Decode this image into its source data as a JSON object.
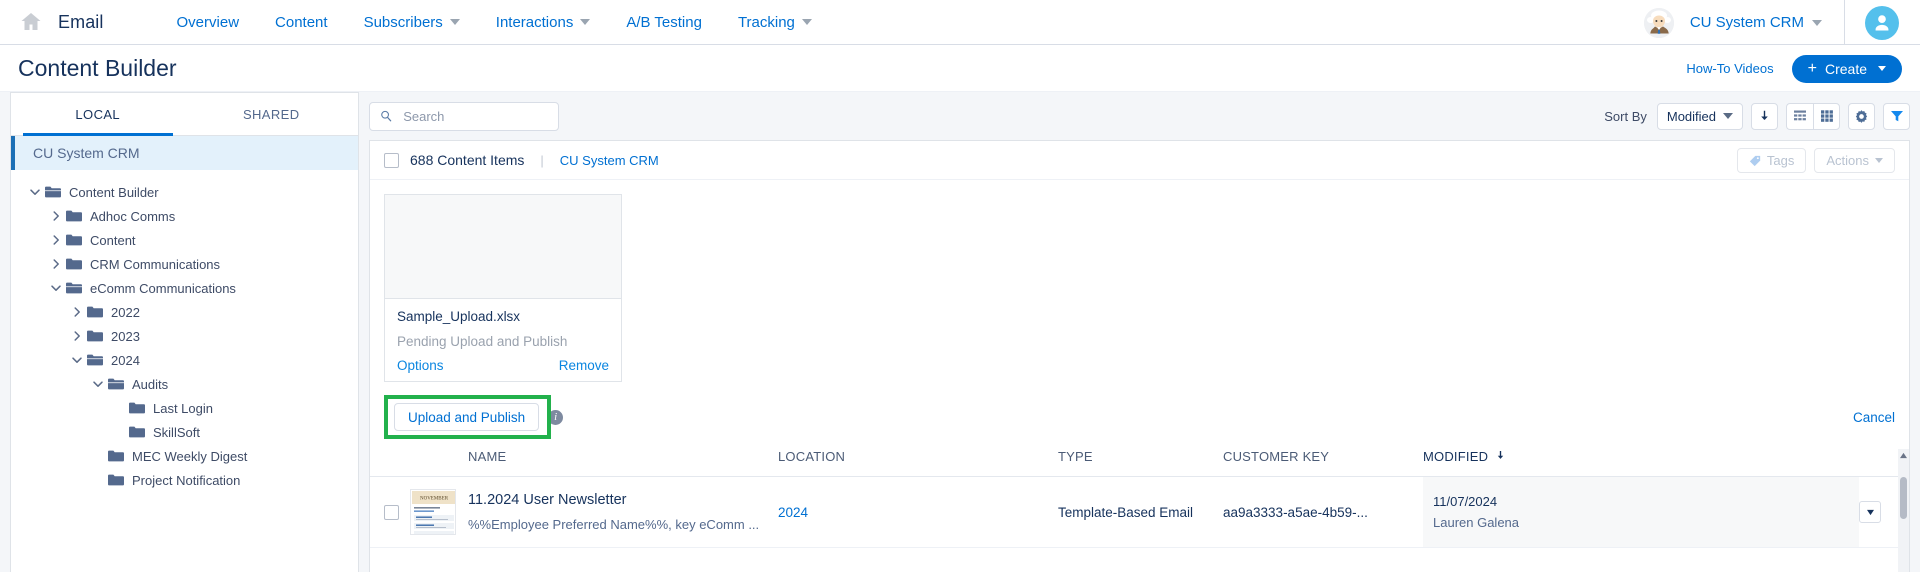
{
  "topnav": {
    "home_icon": "home-icon",
    "app_name": "Email",
    "items": [
      {
        "label": "Overview",
        "caret": false
      },
      {
        "label": "Content",
        "caret": false
      },
      {
        "label": "Subscribers",
        "caret": true
      },
      {
        "label": "Interactions",
        "caret": true
      },
      {
        "label": "A/B Testing",
        "caret": false
      },
      {
        "label": "Tracking",
        "caret": true
      }
    ],
    "assistant_icon": "einstein-assistant-icon",
    "org": "CU System CRM",
    "avatar_icon": "user-avatar-icon"
  },
  "header": {
    "title": "Content Builder",
    "howto": "How-To Videos",
    "create": "Create",
    "create_plus": "+"
  },
  "sidebar": {
    "tabs": [
      {
        "label": "LOCAL",
        "active": true
      },
      {
        "label": "SHARED",
        "active": false
      }
    ],
    "root": "CU System CRM",
    "tree": [
      {
        "label": "Content Builder",
        "indent": 0,
        "twisty": "down",
        "folder": "open"
      },
      {
        "label": "Adhoc Comms",
        "indent": 1,
        "twisty": "right",
        "folder": "closed"
      },
      {
        "label": "Content",
        "indent": 1,
        "twisty": "right",
        "folder": "closed"
      },
      {
        "label": "CRM Communications",
        "indent": 1,
        "twisty": "right",
        "folder": "closed"
      },
      {
        "label": "eComm Communications",
        "indent": 1,
        "twisty": "down",
        "folder": "open"
      },
      {
        "label": "2022",
        "indent": 2,
        "twisty": "right",
        "folder": "closed"
      },
      {
        "label": "2023",
        "indent": 2,
        "twisty": "right",
        "folder": "closed"
      },
      {
        "label": "2024",
        "indent": 2,
        "twisty": "down",
        "folder": "open"
      },
      {
        "label": "Audits",
        "indent": 3,
        "twisty": "down",
        "folder": "open"
      },
      {
        "label": "Last Login",
        "indent": 4,
        "twisty": "none",
        "folder": "closed"
      },
      {
        "label": "SkillSoft",
        "indent": 4,
        "twisty": "none",
        "folder": "closed"
      },
      {
        "label": "MEC Weekly Digest",
        "indent": 3,
        "twisty": "none",
        "folder": "closed"
      },
      {
        "label": "Project Notification",
        "indent": 3,
        "twisty": "none",
        "folder": "closed"
      }
    ]
  },
  "toolbar": {
    "search_placeholder": "Search",
    "search_value": "",
    "search_icon": "search-icon",
    "sort_by_label": "Sort By",
    "sort_by_value": "Modified",
    "sort_dir_icon": "arrow-down-icon",
    "list_view_icon": "list-view-icon",
    "grid_view_icon": "grid-view-icon",
    "settings_icon": "gear-icon",
    "filter_icon": "filter-icon"
  },
  "contentbar": {
    "items_count": "688 Content Items",
    "separator": "|",
    "breadcrumb": "CU System CRM",
    "tags_label": "Tags",
    "tags_icon": "tag-icon",
    "actions_label": "Actions"
  },
  "upload": {
    "file_name": "Sample_Upload.xlsx",
    "status": "Pending Upload and Publish",
    "options_label": "Options",
    "remove_label": "Remove",
    "publish_label": "Upload and Publish",
    "info_icon": "info-icon",
    "info_glyph": "i",
    "cancel_label": "Cancel",
    "highlight_color": "#22b14c"
  },
  "table": {
    "columns": [
      {
        "label": "NAME",
        "sorted": false
      },
      {
        "label": "LOCATION",
        "sorted": false
      },
      {
        "label": "TYPE",
        "sorted": false
      },
      {
        "label": "CUSTOMER KEY",
        "sorted": false
      },
      {
        "label": "MODIFIED",
        "sorted": true,
        "sort_icon": "arrow-down-icon"
      }
    ],
    "rows": [
      {
        "name": "11.2024 User Newsletter",
        "preview": "%%Employee Preferred Name%%, key eComm ...",
        "thumb_label": "NOVEMBER",
        "location": "2024",
        "type": "Template-Based Email",
        "customer_key": "aa9a3333-a5ae-4b59-...",
        "modified_date": "11/07/2024",
        "modified_by": "Lauren Galena",
        "menu_icon": "chevron-down-icon"
      }
    ]
  },
  "colors": {
    "brand_blue": "#0070d2",
    "text_navy": "#16325c",
    "highlight_green": "#22b14c"
  }
}
